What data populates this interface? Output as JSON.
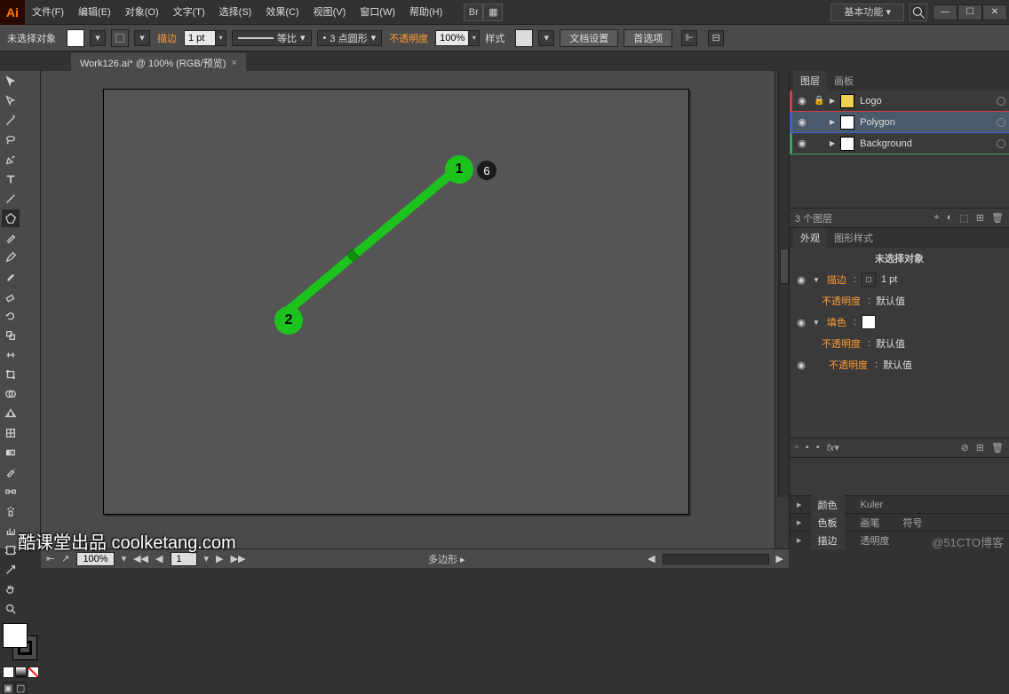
{
  "menu": {
    "items": [
      "文件(F)",
      "编辑(E)",
      "对象(O)",
      "文字(T)",
      "选择(S)",
      "效果(C)",
      "视图(V)",
      "窗口(W)",
      "帮助(H)"
    ],
    "workspace": "基本功能"
  },
  "control": {
    "selection_label": "未选择对象",
    "stroke_label": "描边",
    "stroke_weight": "1 pt",
    "uniform": "等比",
    "profile": "3 点圆形",
    "opacity_label": "不透明度",
    "opacity_value": "100%",
    "style_label": "样式",
    "doc_setup": "文档设置",
    "prefs": "首选项"
  },
  "document": {
    "tab_title": "Work126.ai* @ 100% (RGB/预览)"
  },
  "canvas": {
    "marker1": "1",
    "marker2": "2",
    "badge": "6"
  },
  "layers_panel": {
    "tab_layers": "图层",
    "tab_artboards": "画板",
    "rows": [
      {
        "name": "Logo",
        "locked": true
      },
      {
        "name": "Polygon",
        "selected": true
      },
      {
        "name": "Background"
      }
    ],
    "footer_count": "3 个图层"
  },
  "appearance_panel": {
    "tab_appearance": "外观",
    "tab_graphic_styles": "图形样式",
    "title": "未选择对象",
    "stroke_label": "描边",
    "stroke_value": "1 pt",
    "fill_label": "填色",
    "opacity_label": "不透明度",
    "opacity_value": "默认值"
  },
  "bottom_panels": {
    "color": "颜色",
    "kuler": "Kuler",
    "swatches": "色板",
    "brushes": "画笔",
    "symbols": "符号",
    "stroke2": "描边",
    "transparency": "透明度"
  },
  "status": {
    "zoom": "100%",
    "artboard_num": "1",
    "tool_hint": "多边形"
  },
  "watermark": "酷课堂出品 coolketang.com",
  "watermark2": "@51CTO博客"
}
